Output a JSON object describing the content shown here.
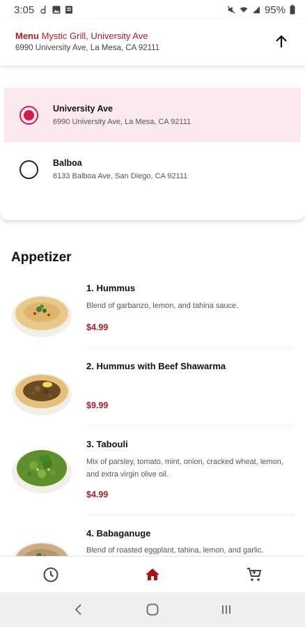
{
  "status_bar": {
    "time": "3:05",
    "battery": "95%"
  },
  "header": {
    "menu_label": "Menu",
    "restaurant_location": "Mystic Grill, University Ave",
    "address": "6990 University Ave, La Mesa, CA 92111",
    "scroll_up_icon": "arrow-up-icon"
  },
  "locations": [
    {
      "name": "University Ave",
      "address": "6990 University Ave, La Mesa, CA 92111",
      "selected": true
    },
    {
      "name": "Balboa",
      "address": "6133 Balboa Ave, San Diego, CA 92111",
      "selected": false
    }
  ],
  "menu": {
    "section": "Appetizer",
    "items": [
      {
        "name": "1. Hummus",
        "description": "Blend of garbanzo, lemon, and tahina sauce.",
        "price": "$4.99",
        "image": "hummus"
      },
      {
        "name": "2. Hummus with Beef Shawarma",
        "description": "",
        "price": "$9.99",
        "image": "hummus-shawarma"
      },
      {
        "name": "3. Tabouli",
        "description": "Mix of parsley, tomato, mint, onion, cracked wheat, lemon, and extra virgin olive oil.",
        "price": "$4.99",
        "image": "tabouli"
      },
      {
        "name": "4. Babaganuge",
        "description": "Blend of roasted eggplant, tahina, lemon, and garlic.",
        "price": "",
        "image": "babaganuge"
      }
    ]
  },
  "bottom_nav": [
    {
      "icon": "clock-icon",
      "active": false
    },
    {
      "icon": "home-icon",
      "active": true
    },
    {
      "icon": "cart-icon",
      "active": false
    }
  ],
  "colors": {
    "accent": "#b01c24",
    "radio_selected": "#d31b4e",
    "selected_bg": "#fbe9ee"
  }
}
